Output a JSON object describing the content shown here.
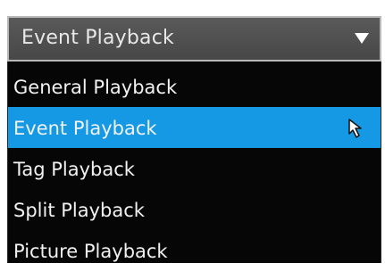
{
  "dropdown": {
    "selected_value": "Event Playback",
    "options": [
      {
        "label": "General Playback"
      },
      {
        "label": "Event Playback"
      },
      {
        "label": "Tag Playback"
      },
      {
        "label": "Split Playback"
      },
      {
        "label": "Picture Playback"
      }
    ],
    "selected_index": 1,
    "caret_icon": "caret-down-icon",
    "cursor_icon": "mouse-pointer-icon"
  },
  "colors": {
    "highlight": "#1599e4",
    "list_background": "#060606",
    "header_background": "#4f4f4f"
  }
}
